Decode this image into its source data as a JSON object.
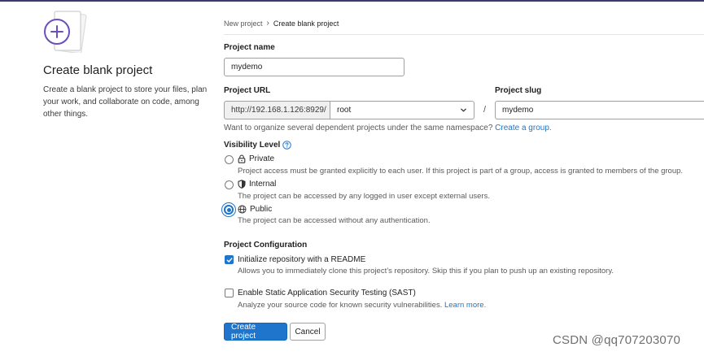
{
  "left": {
    "title": "Create blank project",
    "description": "Create a blank project to store your files, plan your work, and collaborate on code, among other things."
  },
  "breadcrumb": {
    "parent": "New project",
    "current": "Create blank project"
  },
  "project_name": {
    "label": "Project name",
    "value": "mydemo"
  },
  "project_url": {
    "label": "Project URL",
    "prefix": "http://192.168.1.126:8929/",
    "namespace": "root",
    "separator": "/"
  },
  "project_slug": {
    "label": "Project slug",
    "value": "mydemo"
  },
  "namespace_help": {
    "text": "Want to organize several dependent projects under the same namespace?",
    "link": "Create a group."
  },
  "visibility": {
    "label": "Visibility Level",
    "options": [
      {
        "label": "Private",
        "description": "Project access must be granted explicitly to each user. If this project is part of a group, access is granted to members of the group.",
        "icon": "lock-icon",
        "checked": false
      },
      {
        "label": "Internal",
        "description": "The project can be accessed by any logged in user except external users.",
        "icon": "shield-icon",
        "checked": false
      },
      {
        "label": "Public",
        "description": "The project can be accessed without any authentication.",
        "icon": "globe-icon",
        "checked": true
      }
    ]
  },
  "configuration": {
    "label": "Project Configuration",
    "readme": {
      "label": "Initialize repository with a README",
      "description": "Allows you to immediately clone this project’s repository. Skip this if you plan to push up an existing repository.",
      "checked": true
    },
    "sast": {
      "label": "Enable Static Application Security Testing (SAST)",
      "description": "Analyze your source code for known security vulnerabilities.",
      "link": "Learn more.",
      "checked": false
    }
  },
  "buttons": {
    "create": "Create project",
    "cancel": "Cancel"
  },
  "watermark": "CSDN @qq707203070",
  "colors": {
    "accent": "#1f75cb",
    "header_bar": "#3b3a6b",
    "illustration_purple": "#6b4fbb"
  }
}
